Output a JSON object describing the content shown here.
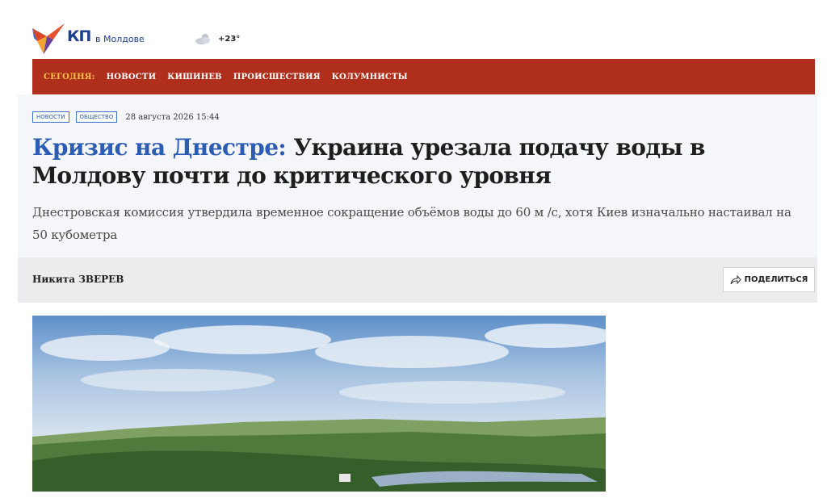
{
  "header": {
    "logo_kp": "КП",
    "logo_region": "в Молдове",
    "weather_temp": "+23°"
  },
  "nav": {
    "today": "СЕГОДНЯ:",
    "items": [
      "НОВОСТИ",
      "КИШИНЕВ",
      "ПРОИСШЕСТВИЯ",
      "КОЛУМНИСТЫ"
    ]
  },
  "article": {
    "tags": [
      "НОВОСТИ",
      "ОБЩЕСТВО"
    ],
    "date": "28 августа 2026 15:44",
    "headline_accent": "Кризис на Днестре:",
    "headline_rest": "Украина урезала подачу воды в Молдову почти до критического уровня",
    "lead": "Днестровская комиссия утвердила временное сокращение объёмов воды до 60 м /с, хотя Киев изначально настаивал на 50 кубометра",
    "author": "Никита ЗВЕРЕВ",
    "share_label": "ПОДЕЛИТЬСЯ"
  },
  "colors": {
    "nav_bg": "#b02e1c",
    "today": "#f6c34a",
    "accent": "#2d5cb5",
    "logo": "#1d3f8f"
  }
}
